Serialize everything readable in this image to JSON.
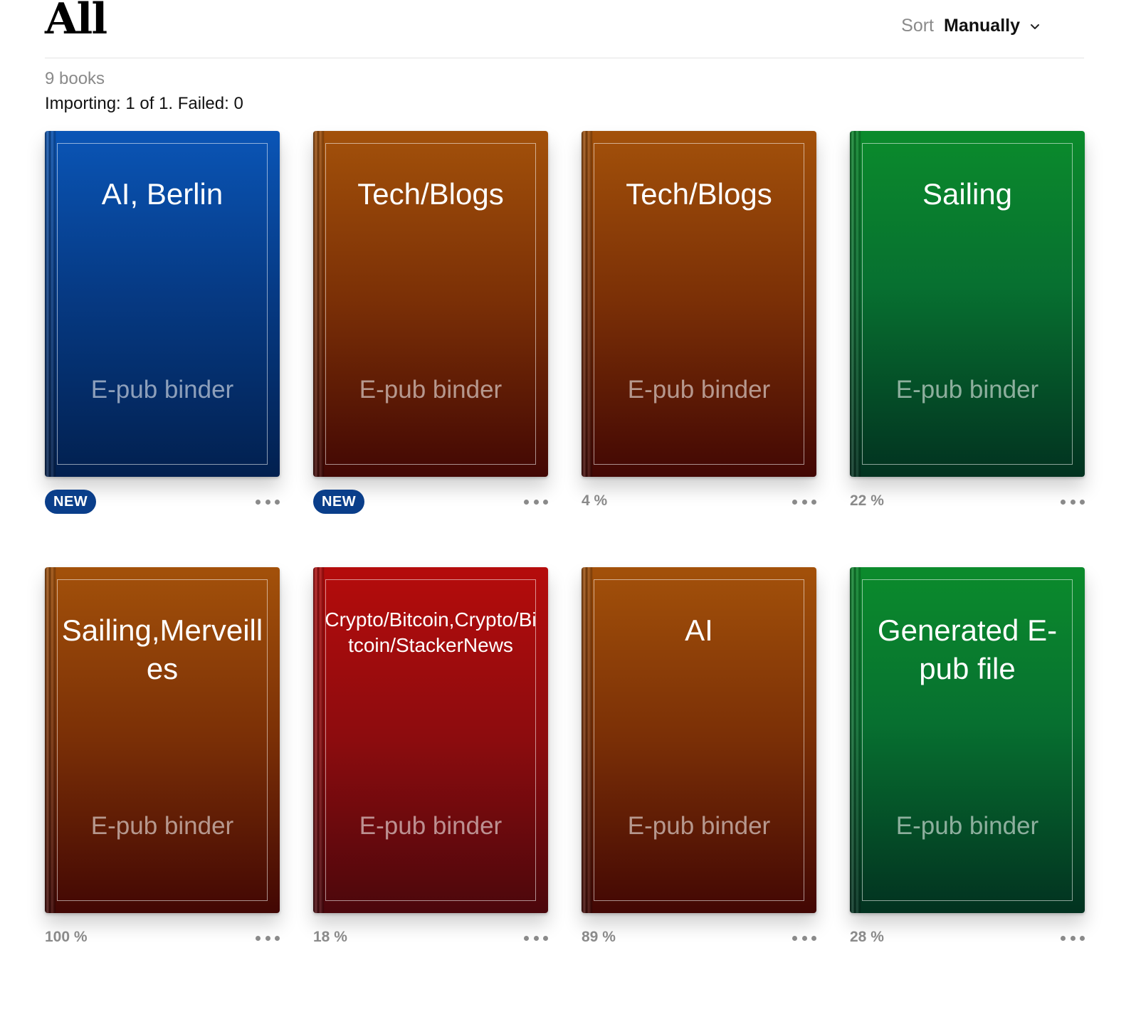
{
  "header": {
    "title": "All",
    "sort_label": "Sort",
    "sort_value": "Manually"
  },
  "library": {
    "count_text": "9 books",
    "import_status": "Importing: 1 of 1. Failed: 0"
  },
  "books": [
    {
      "title": "AI, Berlin",
      "subtitle": "E-pub binder",
      "badge": "NEW",
      "progress": "",
      "color": "blue"
    },
    {
      "title": "Tech/Blogs",
      "subtitle": "E-pub binder",
      "badge": "NEW",
      "progress": "",
      "color": "orange"
    },
    {
      "title": "Tech/Blogs",
      "subtitle": "E-pub binder",
      "badge": "",
      "progress": "4 %",
      "color": "orange"
    },
    {
      "title": "Sailing",
      "subtitle": "E-pub binder",
      "badge": "",
      "progress": "22 %",
      "color": "green"
    },
    {
      "title": "Sailing,Merveilles",
      "subtitle": "E-pub binder",
      "badge": "",
      "progress": "100 %",
      "color": "orange"
    },
    {
      "title": "Crypto/Bitcoin,Crypto/Bitcoin/StackerNews",
      "subtitle": "E-pub binder",
      "badge": "",
      "progress": "18 %",
      "color": "red"
    },
    {
      "title": "AI",
      "subtitle": "E-pub binder",
      "badge": "",
      "progress": "89 %",
      "color": "orange"
    },
    {
      "title": "Generated E-pub file",
      "subtitle": "E-pub binder",
      "badge": "",
      "progress": "28 %",
      "color": "green"
    }
  ],
  "colors": {
    "blue": "#0a55b6",
    "orange": "#a3510a",
    "green": "#0b8b2c",
    "red": "#b50c0c",
    "badge": "#0a3e8a"
  },
  "icons": {
    "sort_chevron": "chevron-down-icon",
    "more": "more-horizontal-icon"
  }
}
